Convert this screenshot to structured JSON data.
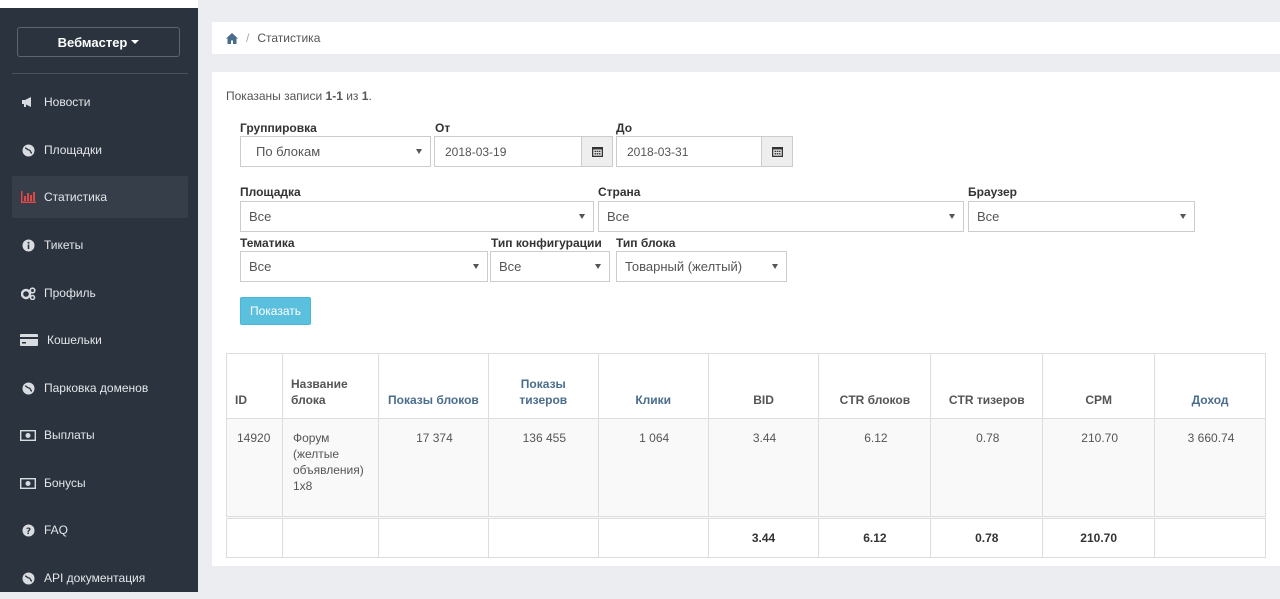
{
  "sidebar": {
    "role_button": "Вебмастер",
    "items": [
      {
        "label": "Новости",
        "icon": "bullhorn-icon"
      },
      {
        "label": "Площадки",
        "icon": "globe-icon"
      },
      {
        "label": "Статистика",
        "icon": "bar-chart-icon",
        "active": true
      },
      {
        "label": "Тикеты",
        "icon": "info-circle-icon"
      },
      {
        "label": "Профиль",
        "icon": "gears-icon"
      },
      {
        "label": "Кошельки",
        "icon": "credit-card-icon"
      },
      {
        "label": "Парковка доменов",
        "icon": "globe-icon"
      },
      {
        "label": "Выплаты",
        "icon": "money-icon"
      },
      {
        "label": "Бонусы",
        "icon": "money-icon"
      },
      {
        "label": "FAQ",
        "icon": "question-circle-icon"
      },
      {
        "label": "API документация",
        "icon": "globe-icon"
      }
    ],
    "active_color": "#e04848"
  },
  "breadcrumb": {
    "home_icon": "home-icon",
    "separator": "/",
    "current": "Статистика"
  },
  "summary": {
    "prefix": "Показаны записи ",
    "range": "1-1",
    "middle": " из ",
    "total": "1",
    "suffix": "."
  },
  "filters": {
    "grouping": {
      "label": "Группировка",
      "value": "По блокам"
    },
    "date_from": {
      "label": "От",
      "value": "2018-03-19"
    },
    "date_to": {
      "label": "До",
      "value": "2018-03-31"
    },
    "site": {
      "label": "Площадка",
      "value": "Все"
    },
    "country": {
      "label": "Страна",
      "value": "Все"
    },
    "browser": {
      "label": "Браузер",
      "value": "Все"
    },
    "topic": {
      "label": "Тематика",
      "value": "Все"
    },
    "config_type": {
      "label": "Тип конфигурации",
      "value": "Все"
    },
    "block_type": {
      "label": "Тип блока",
      "value": "Товарный (желтый)"
    },
    "submit": "Показать"
  },
  "table": {
    "headers": [
      "ID",
      "Название блока",
      "Показы блоков",
      "Показы тизеров",
      "Клики",
      "BID",
      "CTR блоков",
      "CTR тизеров",
      "CPM",
      "Доход"
    ],
    "rows": [
      [
        "14920",
        "Форум (желтые объявления) 1x8",
        "17 374",
        "136 455",
        "1 064",
        "3.44",
        "6.12",
        "0.78",
        "210.70",
        "3 660.74"
      ]
    ],
    "totals": [
      "",
      "",
      "",
      "",
      "",
      "3.44",
      "6.12",
      "0.78",
      "210.70",
      ""
    ]
  },
  "colors": {
    "sidebar_bg": "#2b333e",
    "button_info": "#5bc0de",
    "link_header": "#4a6d8c"
  }
}
